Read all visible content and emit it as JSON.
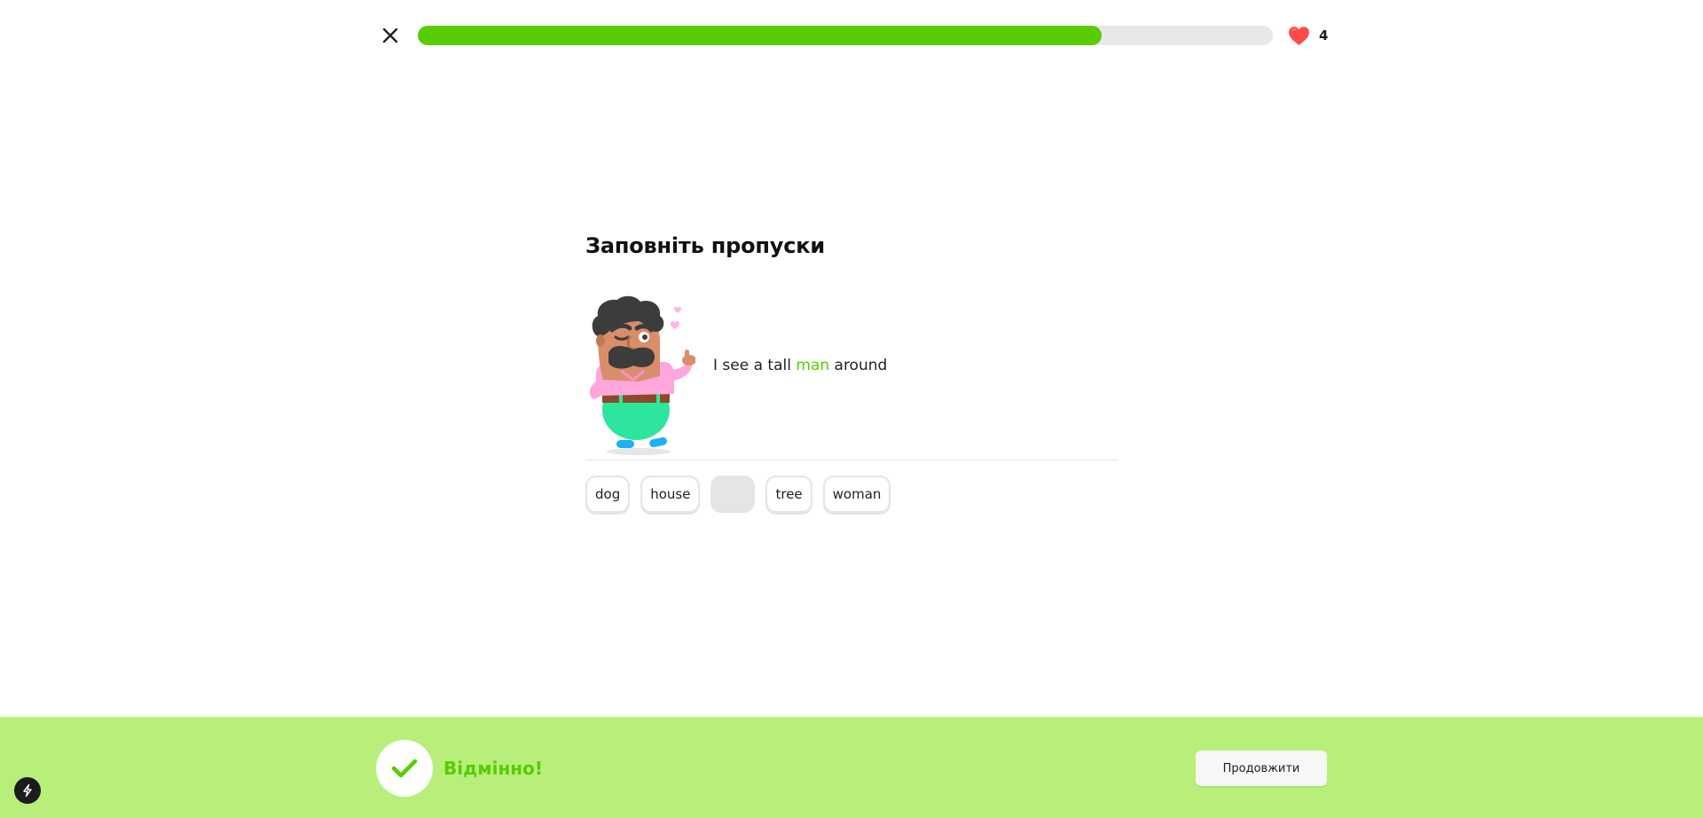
{
  "header": {
    "close_icon": "close-icon",
    "progress_fraction": 0.8,
    "hearts_icon": "heart-icon",
    "hearts_count": "4"
  },
  "main": {
    "title": "Заповніть пропуски",
    "character_icon": "mustached-man-character",
    "sentence": {
      "before": "I see a tall ",
      "answer": "man",
      "after": " around"
    },
    "word_bank": [
      {
        "label": "dog",
        "used": false
      },
      {
        "label": "house",
        "used": false
      },
      {
        "label": "",
        "used": true
      },
      {
        "label": "tree",
        "used": false
      },
      {
        "label": "woman",
        "used": false
      }
    ]
  },
  "footer": {
    "check_icon": "check-icon",
    "feedback": "Відмінно!",
    "continue_label": "Продовжити"
  },
  "misc": {
    "lightning_icon": "lightning-icon"
  },
  "colors": {
    "accent_green": "#58cc02",
    "footer_background": "#b8ef7b",
    "heart_red": "#ff4b4b",
    "progress_track": "#e8e8e8"
  }
}
